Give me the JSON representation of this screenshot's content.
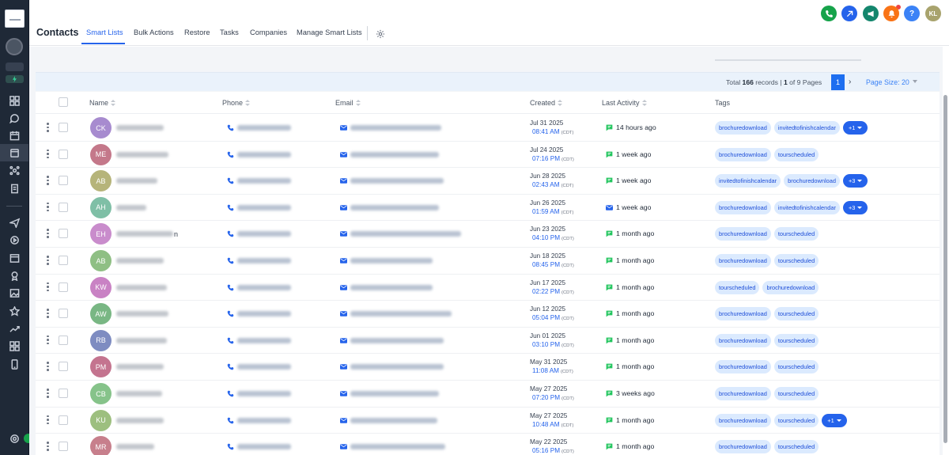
{
  "header": {
    "title": "Contacts",
    "tabs": [
      {
        "label": "Smart Lists",
        "active": true
      },
      {
        "label": "Bulk Actions",
        "active": false
      },
      {
        "label": "Restore",
        "active": false
      },
      {
        "label": "Tasks",
        "active": false
      },
      {
        "label": "Companies",
        "active": false
      },
      {
        "label": "Manage Smart Lists",
        "active": false
      }
    ],
    "settings_icon": "gear-icon"
  },
  "topbar_icons": [
    {
      "name": "phone-icon",
      "color": "#16a34a"
    },
    {
      "name": "integration-icon",
      "color": "#2563eb"
    },
    {
      "name": "megaphone-icon",
      "color": "#14866d",
      "badge": true
    },
    {
      "name": "bell-icon",
      "color": "#f97316"
    },
    {
      "name": "help-icon",
      "label": "?",
      "color": "#3b82f6"
    },
    {
      "name": "user-avatar",
      "label": "KL",
      "color": "#a8a36d"
    }
  ],
  "sidebar": {
    "icons": [
      "contacts-icon",
      "search-icon",
      "bolt-icon",
      "dashboard-icon",
      "conversations-icon",
      "calendar-icon",
      "contacts-list-icon",
      "opportunities-icon",
      "payments-icon",
      "marketing-icon",
      "automation-icon",
      "sites-icon",
      "memberships-icon",
      "media-icon",
      "reputation-icon",
      "reporting-icon",
      "app-marketplace-icon",
      "mobile-app-icon",
      "settings-icon"
    ]
  },
  "pagination": {
    "total_prefix": "Total",
    "total": "166",
    "total_suffix": "records |",
    "page": "1",
    "pages_text": "of 9 Pages",
    "current_page": "1",
    "page_size": "Page Size: 20"
  },
  "columns": {
    "name": "Name",
    "phone": "Phone",
    "email": "Email",
    "created": "Created",
    "last_activity": "Last Activity",
    "tags": "Tags"
  },
  "colors": {
    "accent": "#2563eb",
    "tag_bg": "#dbeafe",
    "activity_green": "#22c55e"
  },
  "rows": [
    {
      "initials": "CK",
      "avatar": "#a78bcf",
      "name_suffix": "",
      "date": "Jul 31 2025",
      "time": "08:41 AM",
      "tz": "(CDT)",
      "activity": "14 hours ago",
      "activity_icon": "message-icon",
      "tags": [
        "brochuredownload",
        "invitedtofinishcalendar"
      ],
      "more": "+1"
    },
    {
      "initials": "ME",
      "avatar": "#c4788a",
      "name_suffix": "",
      "date": "Jul 24 2025",
      "time": "07:16 PM",
      "tz": "(CDT)",
      "activity": "1 week ago",
      "activity_icon": "message-icon",
      "tags": [
        "brochuredownload",
        "tourscheduled"
      ],
      "more": ""
    },
    {
      "initials": "AB",
      "avatar": "#b6b47a",
      "name_suffix": "",
      "date": "Jun 28 2025",
      "time": "02:43 AM",
      "tz": "(CDT)",
      "activity": "1 week ago",
      "activity_icon": "message-icon",
      "tags": [
        "invitedtofinishcalendar",
        "brochuredownload"
      ],
      "more": "+3"
    },
    {
      "initials": "AH",
      "avatar": "#7fbfa6",
      "name_suffix": "",
      "date": "Jun 26 2025",
      "time": "01:59 AM",
      "tz": "(CDT)",
      "activity": "1 week ago",
      "activity_icon": "mail-icon",
      "tags": [
        "brochuredownload",
        "invitedtofinishcalendar"
      ],
      "more": "+3"
    },
    {
      "initials": "EH",
      "avatar": "#c98ccc",
      "name_suffix": "n",
      "date": "Jun 23 2025",
      "time": "04:10 PM",
      "tz": "(CDT)",
      "activity": "1 month ago",
      "activity_icon": "message-icon",
      "tags": [
        "brochuredownload",
        "tourscheduled"
      ],
      "more": ""
    },
    {
      "initials": "AB",
      "avatar": "#8fbf84",
      "name_suffix": "",
      "date": "Jun 18 2025",
      "time": "08:45 PM",
      "tz": "(CDT)",
      "activity": "1 month ago",
      "activity_icon": "message-icon",
      "tags": [
        "brochuredownload",
        "tourscheduled"
      ],
      "more": ""
    },
    {
      "initials": "KW",
      "avatar": "#c982c4",
      "name_suffix": "",
      "date": "Jun 17 2025",
      "time": "02:22 PM",
      "tz": "(CDT)",
      "activity": "1 month ago",
      "activity_icon": "message-icon",
      "tags": [
        "tourscheduled",
        "brochuredownload"
      ],
      "more": ""
    },
    {
      "initials": "AW",
      "avatar": "#79b784",
      "name_suffix": "",
      "date": "Jun 12 2025",
      "time": "05:04 PM",
      "tz": "(CDT)",
      "activity": "1 month ago",
      "activity_icon": "message-icon",
      "tags": [
        "brochuredownload",
        "tourscheduled"
      ],
      "more": ""
    },
    {
      "initials": "RB",
      "avatar": "#7e8cc1",
      "name_suffix": "",
      "date": "Jun 01 2025",
      "time": "03:10 PM",
      "tz": "(CDT)",
      "activity": "1 month ago",
      "activity_icon": "message-icon",
      "tags": [
        "brochuredownload",
        "tourscheduled"
      ],
      "more": ""
    },
    {
      "initials": "PM",
      "avatar": "#c4748f",
      "name_suffix": "",
      "date": "May 31 2025",
      "time": "11:08 AM",
      "tz": "(CDT)",
      "activity": "1 month ago",
      "activity_icon": "message-icon",
      "tags": [
        "brochuredownload",
        "tourscheduled"
      ],
      "more": ""
    },
    {
      "initials": "CB",
      "avatar": "#86c38a",
      "name_suffix": "",
      "date": "May 27 2025",
      "time": "07:20 PM",
      "tz": "(CDT)",
      "activity": "3 weeks ago",
      "activity_icon": "message-icon",
      "tags": [
        "brochuredownload",
        "tourscheduled"
      ],
      "more": ""
    },
    {
      "initials": "KU",
      "avatar": "#9dbf7f",
      "name_suffix": "",
      "date": "May 27 2025",
      "time": "10:48 AM",
      "tz": "(CDT)",
      "activity": "1 month ago",
      "activity_icon": "message-icon",
      "tags": [
        "brochuredownload",
        "tourscheduled"
      ],
      "more": "+1"
    },
    {
      "initials": "MR",
      "avatar": "#c77f8c",
      "name_suffix": "",
      "date": "May 22 2025",
      "time": "05:16 PM",
      "tz": "(CDT)",
      "activity": "1 month ago",
      "activity_icon": "message-icon",
      "tags": [
        "brochuredownload",
        "tourscheduled"
      ],
      "more": ""
    }
  ]
}
